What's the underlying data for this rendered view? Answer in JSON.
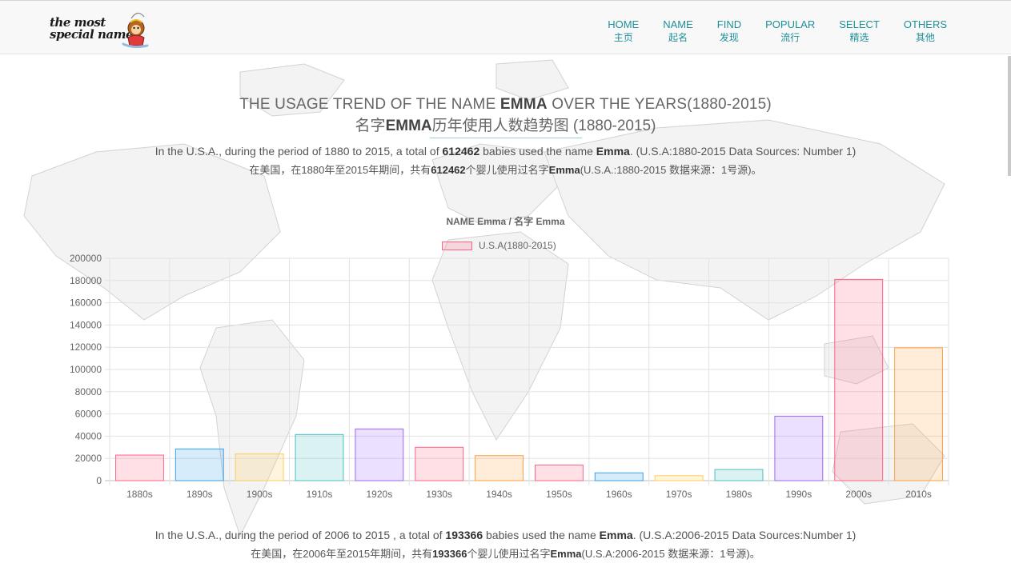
{
  "logo": {
    "line1": "the most",
    "line2": "special name"
  },
  "nav": [
    {
      "en": "HOME",
      "zh": "主页"
    },
    {
      "en": "NAME",
      "zh": "起名"
    },
    {
      "en": "FIND",
      "zh": "发现"
    },
    {
      "en": "POPULAR",
      "zh": "流行"
    },
    {
      "en": "SELECT",
      "zh": "精选"
    },
    {
      "en": "OTHERS",
      "zh": "其他"
    }
  ],
  "header": {
    "title_en_pre": "THE USAGE TREND OF THE NAME ",
    "title_name": "EMMA",
    "title_en_post": " OVER THE YEARS(1880-2015)",
    "title_zh_pre": "名字",
    "title_zh_post": "历年使用人数趋势图",
    "title_zh_range": " (1880-2015)"
  },
  "summary1": {
    "en_pre": "In the U.S.A., during the period of 1880 to 2015, a total of ",
    "en_count": "612462",
    "en_mid": " babies used the name ",
    "en_name": "Emma",
    "en_post": ". (U.S.A:1880-2015 Data Sources: Number 1)",
    "zh_pre": "在美国，在1880年至2015年期间，共有",
    "zh_count": "612462",
    "zh_mid": "个婴儿使用过名字",
    "zh_name": "Emma",
    "zh_post": "(U.S.A.:1880-2015 数据来源：1号源)。"
  },
  "summary2": {
    "en_pre": "In the U.S.A., during the period of 2006 to 2015 , a total of ",
    "en_count": "193366",
    "en_mid": " babies used the name ",
    "en_name": "Emma",
    "en_post": ". (U.S.A:2006-2015 Data Sources:Number 1)",
    "zh_pre": "在美国，在2006年至2015年期间，共有",
    "zh_count": "193366",
    "zh_mid": "个婴儿使用过名字",
    "zh_name": "Emma",
    "zh_post": "(U.S.A:2006-2015 数据来源：1号源)。"
  },
  "chart_data": {
    "type": "bar",
    "title": "NAME Emma / 名字 Emma",
    "legend": "top-center",
    "grid": true,
    "ylim": [
      0,
      200000
    ],
    "yticks": [
      0,
      20000,
      40000,
      60000,
      80000,
      100000,
      120000,
      140000,
      160000,
      180000,
      200000
    ],
    "categories": [
      "1880s",
      "1890s",
      "1900s",
      "1910s",
      "1920s",
      "1930s",
      "1940s",
      "1950s",
      "1960s",
      "1970s",
      "1980s",
      "1990s",
      "2000s",
      "2010s"
    ],
    "series": [
      {
        "name": "U.S.A(1880-2015)",
        "values": [
          23000,
          28500,
          24000,
          41500,
          46500,
          30000,
          22500,
          14000,
          7000,
          4500,
          10000,
          58000,
          181000,
          119500
        ]
      }
    ],
    "colors": [
      {
        "fill": "rgba(255,99,132,0.2)",
        "stroke": "#ff6384"
      },
      {
        "fill": "rgba(54,162,235,0.2)",
        "stroke": "#36a2eb"
      },
      {
        "fill": "rgba(255,206,86,0.2)",
        "stroke": "#ffce56"
      },
      {
        "fill": "rgba(75,192,192,0.2)",
        "stroke": "#4bc0c0"
      },
      {
        "fill": "rgba(153,102,255,0.2)",
        "stroke": "#9966ff"
      },
      {
        "fill": "rgba(255,99,132,0.2)",
        "stroke": "#ff6384"
      },
      {
        "fill": "rgba(255,159,64,0.2)",
        "stroke": "#ff9f40"
      },
      {
        "fill": "rgba(255,99,132,0.2)",
        "stroke": "#ff6384"
      },
      {
        "fill": "rgba(54,162,235,0.2)",
        "stroke": "#36a2eb"
      },
      {
        "fill": "rgba(255,206,86,0.2)",
        "stroke": "#ffce56"
      },
      {
        "fill": "rgba(75,192,192,0.2)",
        "stroke": "#4bc0c0"
      },
      {
        "fill": "rgba(153,102,255,0.2)",
        "stroke": "#9966ff"
      },
      {
        "fill": "rgba(255,99,132,0.2)",
        "stroke": "#ff6384"
      },
      {
        "fill": "rgba(255,159,64,0.2)",
        "stroke": "#ff9f40"
      }
    ]
  }
}
